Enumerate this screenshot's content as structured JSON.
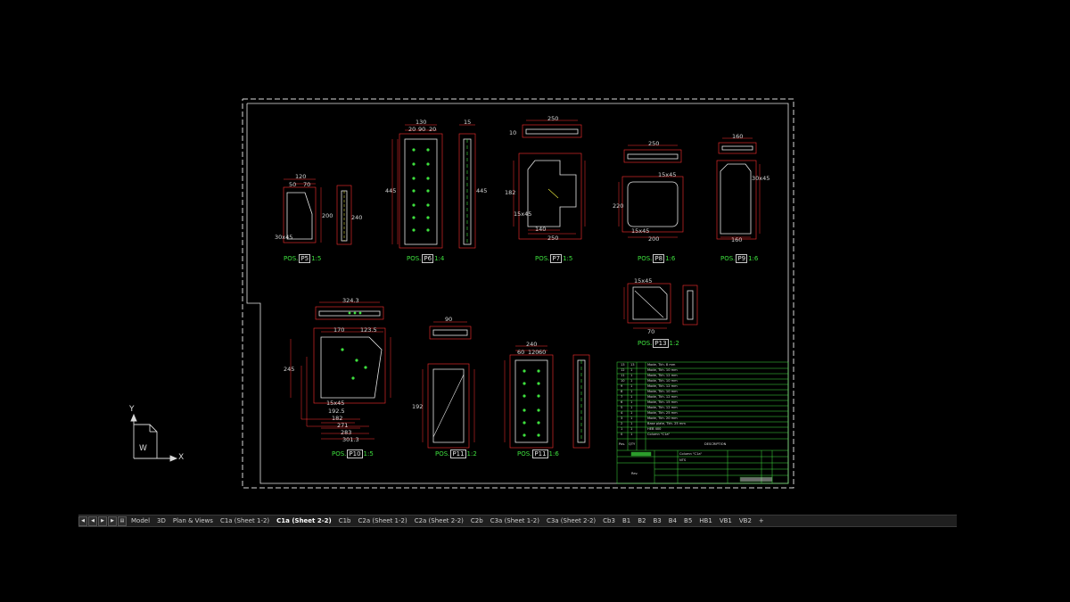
{
  "drawing": {
    "parts": [
      {
        "id": "p5",
        "prefix": "POS.",
        "tag": "P5",
        "suffix": "1:5"
      },
      {
        "id": "p6",
        "prefix": "POS.",
        "tag": "P6",
        "suffix": "1:4"
      },
      {
        "id": "p7",
        "prefix": "POS.",
        "tag": "P7",
        "suffix": "1:5"
      },
      {
        "id": "p8",
        "prefix": "POS.",
        "tag": "P8",
        "suffix": "1:6"
      },
      {
        "id": "p9",
        "prefix": "POS.",
        "tag": "P9",
        "suffix": "1:6"
      },
      {
        "id": "p13",
        "prefix": "POS.",
        "tag": "P13",
        "suffix": "1:2"
      },
      {
        "id": "p10",
        "prefix": "POS.",
        "tag": "P10",
        "suffix": "1:5"
      },
      {
        "id": "p11a",
        "prefix": "POS.",
        "tag": "P11",
        "suffix": "1:2"
      },
      {
        "id": "p11b",
        "prefix": "POS.",
        "tag": "P11",
        "suffix": "1:6"
      }
    ],
    "dimensions": {
      "p5_w": "120",
      "p5_a": "50",
      "p5_b": "70",
      "p5_h1": "200",
      "p5_h2": "240",
      "p5_ch": "30x45",
      "p6_w": "130",
      "p6_a": "20",
      "p6_b": "90",
      "p6_c": "20",
      "p6_h": "445",
      "p6_s": "15",
      "p6_t": "445",
      "p7_w": "250",
      "p7_a": "140",
      "p7_b": "250",
      "p7_h": "182",
      "p7_c": "15x45",
      "p7_t": "10",
      "p8_w": "250",
      "p8_a": "15x45",
      "p8_b": "220",
      "p8_c": "200",
      "p8_d": "15x45",
      "p9_w": "160",
      "p9_h": "30x45",
      "p9_b": "160",
      "p10_w": "324.3",
      "p10_a": "170",
      "p10_b": "123.5",
      "p10_c": "245",
      "p10_d": "192.5",
      "p10_e": "182",
      "p10_f": "271",
      "p10_g": "283",
      "p10_h": "301.3",
      "p10_i": "15x45",
      "p11_w": "90",
      "p11_h": "192",
      "p11b_w": "240",
      "p11b_a": "60",
      "p11b_b": "120",
      "p11b_c": "60",
      "p13_w": "15x45",
      "p13_h": "70"
    },
    "title_block": {
      "rows": [
        {
          "n": "13",
          "q": "13",
          "d": "Mode, Tkh. 8 mm"
        },
        {
          "n": "12",
          "q": "1",
          "d": "Mode, Tkh. 10 mm"
        },
        {
          "n": "11",
          "q": "1",
          "d": "Mode, Tkh. 12 mm"
        },
        {
          "n": "10",
          "q": "1",
          "d": "Mode, Tkh. 10 mm"
        },
        {
          "n": "9",
          "q": "1",
          "d": "Mode, Tkh. 12 mm"
        },
        {
          "n": "8",
          "q": "1",
          "d": "Mode, Tkh. 10 mm"
        },
        {
          "n": "7",
          "q": "1",
          "d": "Mode, Tkh. 12 mm"
        },
        {
          "n": "6",
          "q": "1",
          "d": "Mode, Tkh. 15 mm"
        },
        {
          "n": "5",
          "q": "1",
          "d": "Mode, Tkh. 12 mm"
        },
        {
          "n": "4",
          "q": "1",
          "d": "Mode, Tkh. 25 mm"
        },
        {
          "n": "3",
          "q": "1",
          "d": "Mode, Tkh. 20 mm"
        },
        {
          "n": "2",
          "q": "1",
          "d": "Base plate, Tkh. 25 mm"
        },
        {
          "n": "1",
          "q": "1",
          "d": "HEB 400"
        },
        {
          "n": "0",
          "q": "1",
          "d": "Column \"C1a\""
        }
      ],
      "header_pos": "Pos.",
      "header_qty": "QTY",
      "header_desc": "DESCRIPTION",
      "field_name": "Column \"C1a\"",
      "field_scale": "NTS",
      "field_rev": "Rev."
    },
    "ucs": {
      "y": "Y",
      "x": "X",
      "w": "W"
    }
  },
  "tabs": {
    "nav": [
      "first-icon",
      "prev-icon",
      "next-icon",
      "last-icon",
      "layout-list-icon"
    ],
    "items": [
      {
        "label": "Model",
        "active": false
      },
      {
        "label": "3D",
        "active": false
      },
      {
        "label": "Plan & Views",
        "active": false
      },
      {
        "label": "C1a (Sheet 1-2)",
        "active": false
      },
      {
        "label": "C1a (Sheet 2-2)",
        "active": true
      },
      {
        "label": "C1b",
        "active": false
      },
      {
        "label": "C2a (Sheet 1-2)",
        "active": false
      },
      {
        "label": "C2a (Sheet 2-2)",
        "active": false
      },
      {
        "label": "C2b",
        "active": false
      },
      {
        "label": "C3a (Sheet 1-2)",
        "active": false
      },
      {
        "label": "C3a (Sheet 2-2)",
        "active": false
      },
      {
        "label": "Cb3",
        "active": false
      },
      {
        "label": "B1",
        "active": false
      },
      {
        "label": "B2",
        "active": false
      },
      {
        "label": "B3",
        "active": false
      },
      {
        "label": "B4",
        "active": false
      },
      {
        "label": "B5",
        "active": false
      },
      {
        "label": "HB1",
        "active": false
      },
      {
        "label": "VB1",
        "active": false
      },
      {
        "label": "VB2",
        "active": false
      },
      {
        "label": "+",
        "active": false
      }
    ]
  },
  "colors": {
    "outline": "#e0e0e0",
    "dims": "#ff2a2a",
    "hidden": "#f0f040",
    "bolt": "#3ee03e",
    "table": "#3ee03e"
  }
}
